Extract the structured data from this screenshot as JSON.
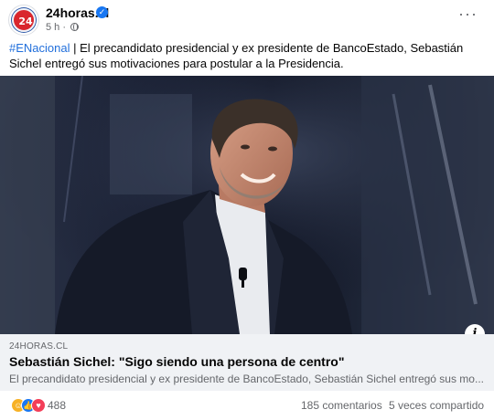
{
  "page": {
    "name": "24horas.cl",
    "avatar_text": "24",
    "time": "5 h",
    "separator": "·"
  },
  "post": {
    "hashtag": "#ENacional",
    "text": " | El precandidato presidencial y ex presidente de BancoEstado, Sebastián Sichel entregó sus motivaciones para postular a la Presidencia."
  },
  "media": {
    "info_label": "i"
  },
  "link_preview": {
    "domain": "24HORAS.CL",
    "title": "Sebastián Sichel: \"Sigo siendo una persona de centro\"",
    "description": "El precandidato presidencial y ex presidente de BancoEstado, Sebastián Sichel entregó sus mo..."
  },
  "footer": {
    "reaction_count": "488",
    "comments": "185 comentarios",
    "shares": "5 veces compartido"
  },
  "icons": {
    "verified": "verified-badge-icon",
    "privacy": "globe-icon",
    "more": "more-options-icon",
    "reactions": [
      "haha-reaction-icon",
      "like-reaction-icon",
      "love-reaction-icon"
    ]
  },
  "colors": {
    "brand_red": "#d9262d",
    "link_blue": "#216fdb",
    "verified_blue": "#1877f2",
    "secondary_text": "#65676b",
    "preview_bg": "#f0f2f5"
  }
}
